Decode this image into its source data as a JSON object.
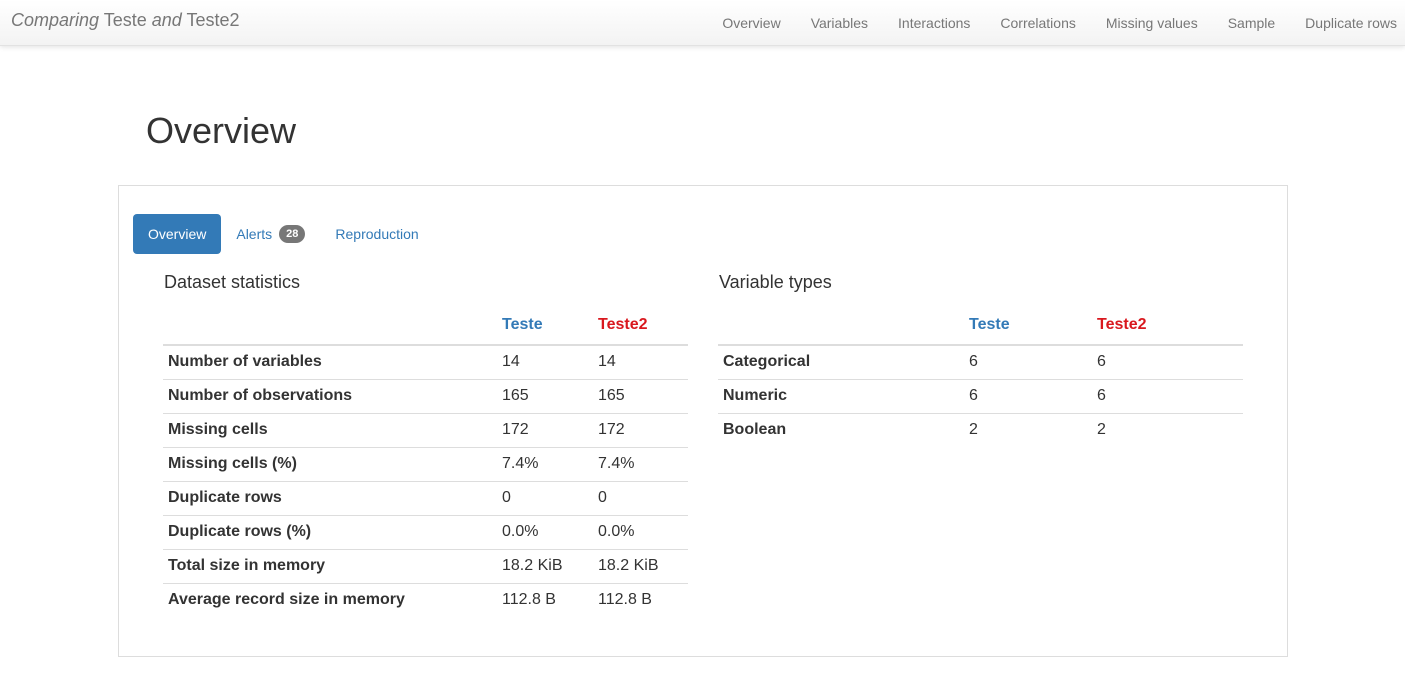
{
  "navbar": {
    "brand": {
      "prefix": "Comparing",
      "first": "Teste",
      "joiner": "and",
      "second": "Teste2"
    },
    "links": [
      "Overview",
      "Variables",
      "Interactions",
      "Correlations",
      "Missing values",
      "Sample",
      "Duplicate rows"
    ]
  },
  "page": {
    "title": "Overview"
  },
  "tabs": {
    "overview": "Overview",
    "alerts": "Alerts",
    "alerts_count": "28",
    "reproduction": "Reproduction"
  },
  "dataset_statistics": {
    "title": "Dataset statistics",
    "columns": [
      "Teste",
      "Teste2"
    ],
    "rows": [
      {
        "label": "Number of variables",
        "values": [
          "14",
          "14"
        ]
      },
      {
        "label": "Number of observations",
        "values": [
          "165",
          "165"
        ]
      },
      {
        "label": "Missing cells",
        "values": [
          "172",
          "172"
        ]
      },
      {
        "label": "Missing cells (%)",
        "values": [
          "7.4%",
          "7.4%"
        ]
      },
      {
        "label": "Duplicate rows",
        "values": [
          "0",
          "0"
        ]
      },
      {
        "label": "Duplicate rows (%)",
        "values": [
          "0.0%",
          "0.0%"
        ]
      },
      {
        "label": "Total size in memory",
        "values": [
          "18.2 KiB",
          "18.2 KiB"
        ]
      },
      {
        "label": "Average record size in memory",
        "values": [
          "112.8 B",
          "112.8 B"
        ]
      }
    ]
  },
  "variable_types": {
    "title": "Variable types",
    "columns": [
      "Teste",
      "Teste2"
    ],
    "rows": [
      {
        "label": "Categorical",
        "values": [
          "6",
          "6"
        ]
      },
      {
        "label": "Numeric",
        "values": [
          "6",
          "6"
        ]
      },
      {
        "label": "Boolean",
        "values": [
          "2",
          "2"
        ]
      }
    ]
  },
  "colors": {
    "teste": "#337ab7",
    "teste2": "#d9181e",
    "active_tab": "#337ab7"
  }
}
